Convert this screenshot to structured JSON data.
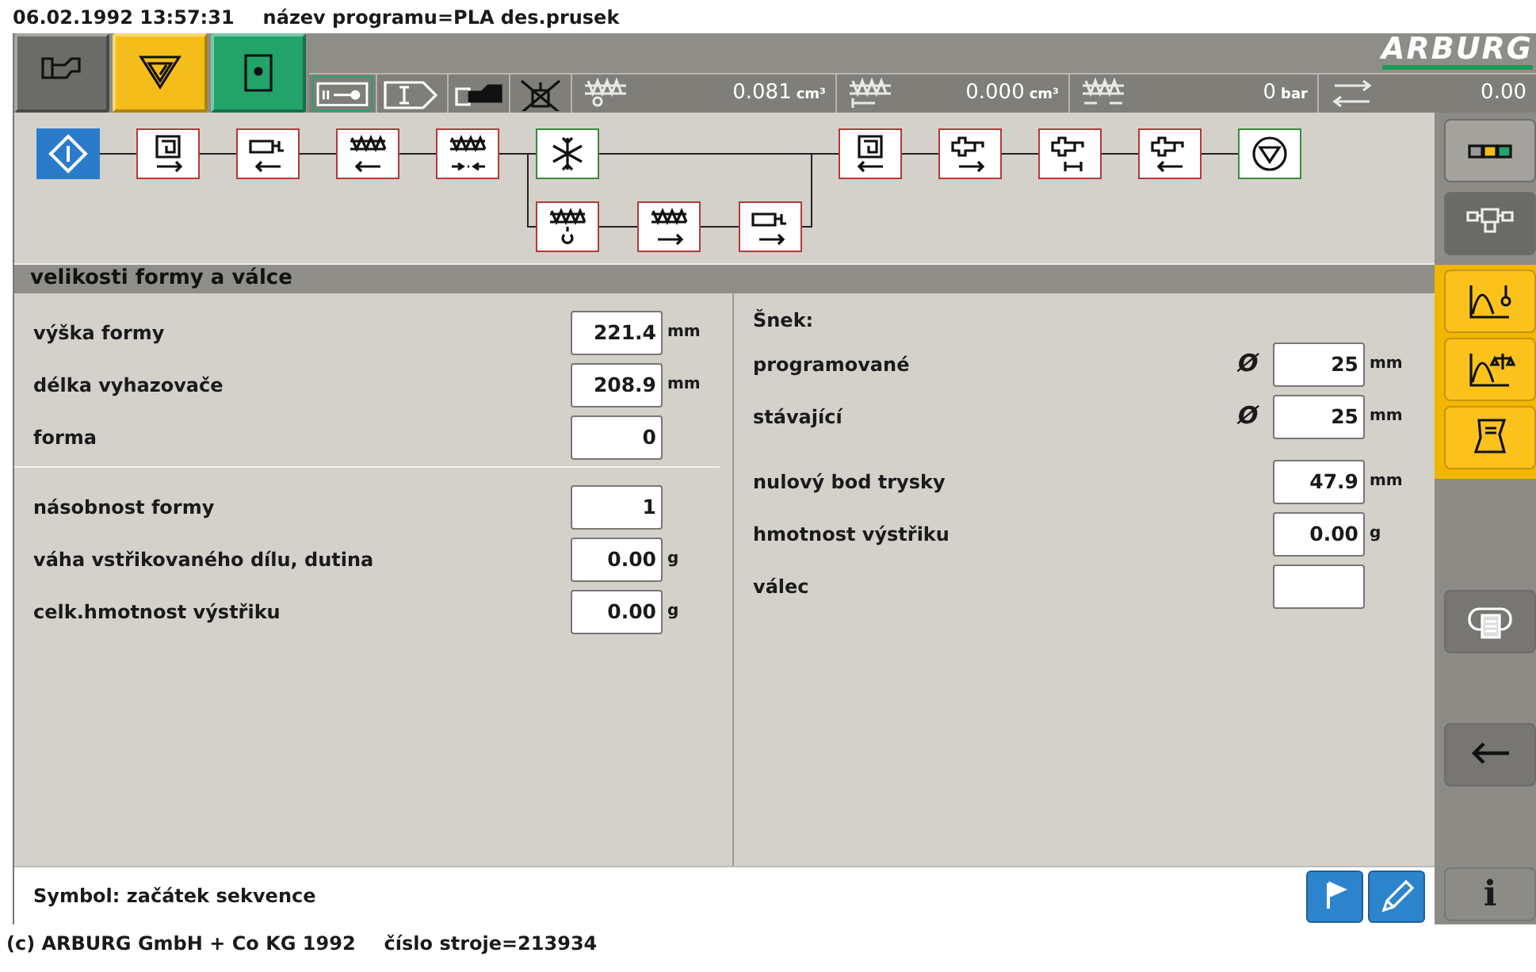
{
  "title_line": {
    "datetime": "06.02.1992 13:57:31",
    "program": "název programu=PLA des.prusek"
  },
  "header_buttons": [
    {
      "kind": "machine",
      "color": "#6b6b68"
    },
    {
      "kind": "warning",
      "color": "#f5bd1a"
    },
    {
      "kind": "door",
      "color": "#22a36a"
    }
  ],
  "logo": "ARBURG",
  "status_icons": [
    {
      "kind": "card-key"
    },
    {
      "kind": "sequence-input"
    },
    {
      "kind": "machine"
    },
    {
      "kind": "no-robot"
    }
  ],
  "metrics": [
    {
      "kind": "shot",
      "value": "0.081",
      "unit": "cm³"
    },
    {
      "kind": "cushion",
      "value": "0.000",
      "unit": "cm³"
    },
    {
      "kind": "pressure",
      "value": "0",
      "unit": "bar"
    },
    {
      "kind": "cycle",
      "value": "0.00"
    }
  ],
  "sequence": {
    "main": [
      {
        "kind": "start",
        "color": "#2a7ccb"
      },
      {
        "kind": "mold-close",
        "color": "#b23a3a"
      },
      {
        "kind": "nozzle-forward",
        "color": "#b23a3a"
      },
      {
        "kind": "injection",
        "color": "#b23a3a"
      },
      {
        "kind": "hold-pressure",
        "color": "#b23a3a"
      },
      {
        "kind": "cooling",
        "color": "#3a8a3a"
      },
      {
        "kind": "mold-open",
        "color": "#b23a3a"
      },
      {
        "kind": "ejector-forward",
        "color": "#b23a3a"
      },
      {
        "kind": "ejector-shake",
        "color": "#b23a3a"
      },
      {
        "kind": "ejector-back",
        "color": "#b23a3a"
      },
      {
        "kind": "end",
        "color": "#3a8a3a"
      }
    ],
    "branch": [
      {
        "kind": "dosing",
        "color": "#b23a3a"
      },
      {
        "kind": "decompression",
        "color": "#b23a3a"
      },
      {
        "kind": "nozzle-back",
        "color": "#b23a3a"
      }
    ]
  },
  "section_title": "velikosti formy a válce",
  "left_groups": [
    [
      {
        "label": "výška formy",
        "value": "221.4",
        "unit": "mm"
      },
      {
        "label": "délka vyhazovače",
        "value": "208.9",
        "unit": "mm"
      },
      {
        "label": "forma",
        "value": "0"
      }
    ],
    [
      {
        "label": "násobnost formy",
        "value": "1"
      },
      {
        "label": "váha vstřikovaného dílu, dutina",
        "value": "0.00",
        "unit": "g"
      },
      {
        "label": "celk.hmotnost výstřiku",
        "value": "0.00",
        "unit": "g"
      }
    ]
  ],
  "right_heading": "Šnek:",
  "right_groups": [
    [
      {
        "label": "programované",
        "prefix": "Ø",
        "value": "25",
        "unit": "mm"
      },
      {
        "label": "stávající",
        "prefix": "Ø",
        "value": "25",
        "unit": "mm"
      }
    ],
    [
      {
        "label": "nulový bod trysky",
        "value": "47.9",
        "unit": "mm"
      },
      {
        "label": "hmotnost výstřiku",
        "value": "0.00",
        "unit": "g"
      },
      {
        "label": "válec"
      }
    ]
  ],
  "message": "Symbol: začátek sekvence",
  "action_buttons": [
    {
      "kind": "flag"
    },
    {
      "kind": "pencil"
    }
  ],
  "sidebar": [
    {
      "kind": "colors",
      "selected": false
    },
    {
      "kind": "sequence",
      "selected": true
    },
    {
      "kind": "graph"
    },
    {
      "kind": "graph-scale"
    },
    {
      "kind": "scroll"
    },
    {
      "kind": "print"
    },
    {
      "kind": "back"
    },
    {
      "kind": "info",
      "label": "i"
    }
  ],
  "footer_line": {
    "copyright": "(c) ARBURG GmbH + Co KG 1992",
    "machine": "číslo stroje=213934"
  }
}
